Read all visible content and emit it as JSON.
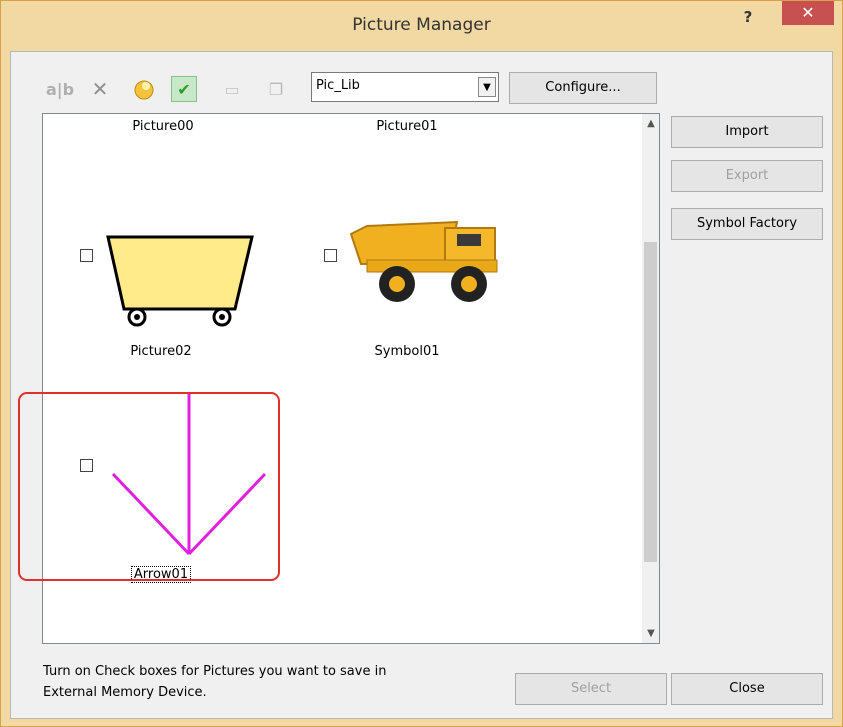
{
  "window": {
    "title": "Picture Manager",
    "help_label": "?",
    "close_label": "✕"
  },
  "toolbar": {
    "icons": [
      "rename-icon",
      "delete-icon",
      "select-all-icon",
      "check-icon",
      "blank-icon",
      "copy-icon"
    ],
    "library_value": "Pic_Lib",
    "configure_label": "Configure..."
  },
  "pictures": [
    {
      "label": "Picture00",
      "checked": false
    },
    {
      "label": "Picture01",
      "checked": false
    },
    {
      "label": "Picture02",
      "checked": false
    },
    {
      "label": "Symbol01",
      "checked": false
    },
    {
      "label": "Arrow01",
      "checked": false
    }
  ],
  "side_buttons": {
    "import_label": "Import",
    "export_label": "Export",
    "symbol_factory_label": "Symbol Factory"
  },
  "hint_line1": "Turn on Check boxes for Pictures you want to save in",
  "hint_line2": "External Memory Device.",
  "bottom_buttons": {
    "select_label": "Select",
    "close_label": "Close"
  },
  "colors": {
    "title_bar": "#f2d9a3",
    "close_button": "#c75050",
    "arrow": "#e020e0",
    "highlight": "#e0302a"
  }
}
